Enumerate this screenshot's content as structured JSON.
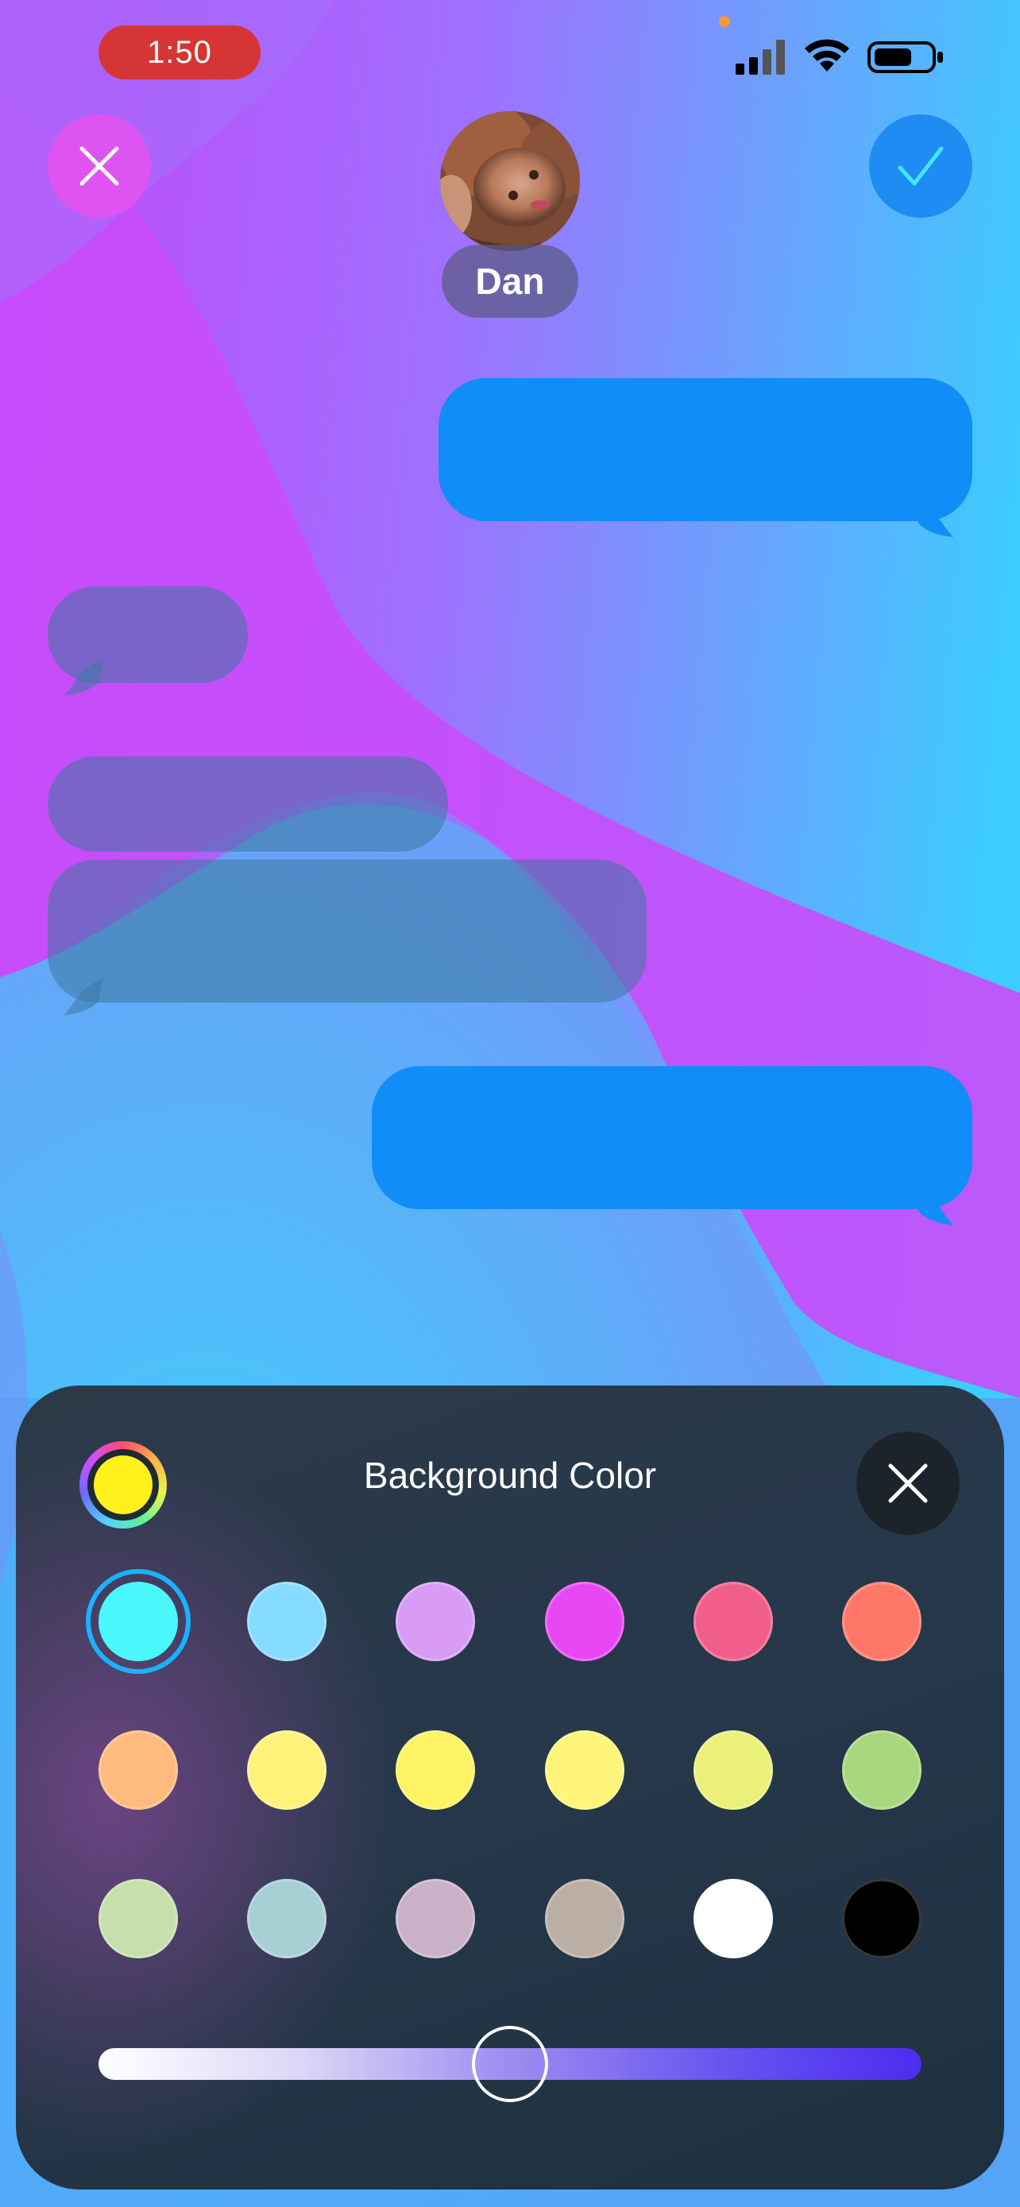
{
  "status_bar": {
    "time": "1:50",
    "icons": [
      "cellular-signal-icon",
      "wifi-icon",
      "battery-icon"
    ]
  },
  "header": {
    "cancel_icon": "close-icon",
    "confirm_icon": "checkmark-icon",
    "contact_name": "Dan"
  },
  "background_colors": {
    "magenta": "#c94cfb",
    "cyan": "#43c8fb",
    "sent_bubble": "#118df7"
  },
  "panel": {
    "title": "Background Color",
    "color_wheel_selected": "#fff21c",
    "swatches": [
      {
        "color": "#4af8fb",
        "selected": true
      },
      {
        "color": "#86dcff",
        "selected": false
      },
      {
        "color": "#d89bf6",
        "selected": false
      },
      {
        "color": "#e848f4",
        "selected": false
      },
      {
        "color": "#f25e8c",
        "selected": false
      },
      {
        "color": "#ff7867",
        "selected": false
      },
      {
        "color": "#ffba7e",
        "selected": false
      },
      {
        "color": "#fff27a",
        "selected": false
      },
      {
        "color": "#fef265",
        "selected": false
      },
      {
        "color": "#fff57a",
        "selected": false
      },
      {
        "color": "#ebf07a",
        "selected": false
      },
      {
        "color": "#a8d77d",
        "selected": false
      },
      {
        "color": "#c6dfad",
        "selected": false
      },
      {
        "color": "#a8cfd3",
        "selected": false
      },
      {
        "color": "#c9b1c8",
        "selected": false
      },
      {
        "color": "#bbaea4",
        "selected": false
      },
      {
        "color": "#ffffff",
        "selected": false
      },
      {
        "color": "#000000",
        "selected": false
      }
    ],
    "slider_value": 0.5
  }
}
